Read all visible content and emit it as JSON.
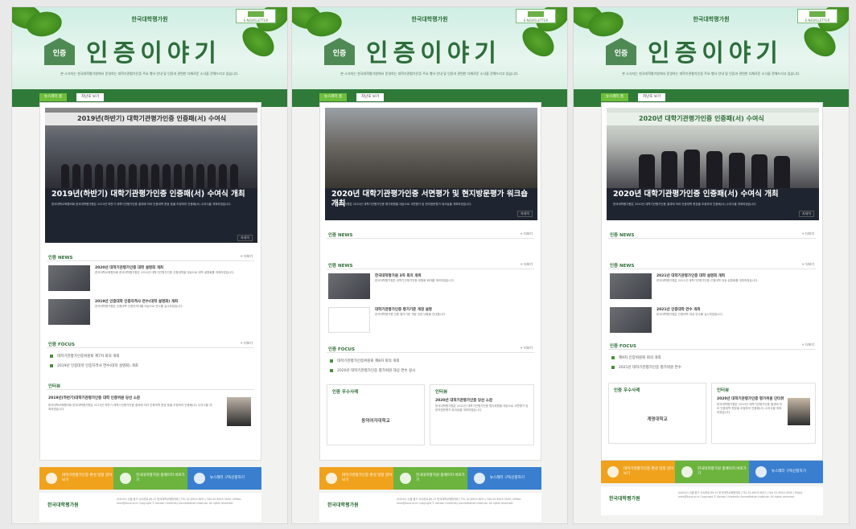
{
  "common": {
    "org_name": "한국대학평가원",
    "newsletter_label": "E-NEWSLETTER",
    "badge_label": "인증",
    "page_title": "인증이야기",
    "intro_text": "본 소식지는 한국대학평가원에서 운영하는 대학기관평가인증 주요 행사 안내 및 인증과 관련한 다채로운 소식을 전해드리고 있습니다.",
    "tab_newsletter": "뉴스레터 홈",
    "tab_archive": "지난호 보기",
    "more": "+ 더보기",
    "detail": "자세히",
    "section_news": "인증 NEWS",
    "section_focus": "인증 FOCUS",
    "section_interview": "인터뷰",
    "section_best": "인증 우수사례",
    "footer_btn1": "대학기관평가인증 편성 일정 알아보기",
    "footer_btn2": "한국대학평가원 홈페이지 바로가기",
    "footer_btn3": "뉴스레터 구독신청하기",
    "footer_logo": "한국대학평가원",
    "footer_text": "(04520) 서울 중구 서소문로 89-31 한국대학교육협의회 | TEL 02-6919-3831 | FAX 02-6919-3939 | EMAIL aims@kcue.or.kr Copyright © Korean University Accreditation Institute. All rights reserved."
  },
  "panels": [
    {
      "feature_banner": "2019년(하반기) 대학기관평가인증 인증패(서) 수여식",
      "feature_title": "2019년(하반기) 대학기관평가인증 인증패(서) 수여식 개최",
      "feature_desc": "한국대학교육협의회 한국대학평가원은 2019년 하반기 대학기관평가인증 결과에 따라 인증대학 총장 등을 초청하여 인증패(서) 수여식을 개최하였습니다.",
      "news": [
        {
          "title": "2020년 대학기관평가인증 대학 설명회 개최",
          "desc": "한국대학교육협의회 한국대학평가원은 2020년 대학기관평가인증 신청대학을 대상으로 대학 설명회를 개최하였습니다."
        },
        {
          "title": "2019년 인증대학 인증자격사 연수(대학 설명회) 개최",
          "desc": "한국대학평가원은 인증대학 인증자격사를 대상으로 연수를 실시하였습니다."
        }
      ],
      "focus": [
        "대학기관평가인증위원회 제7차 회의 개최",
        "2019년 인증대학 인증자격사 연수(대학 설명회) 개최"
      ],
      "interview_title": "2019년(하반기)대학기관평가인증 대학 인증위원 당선 소감"
    },
    {
      "feature_banner": "",
      "feature_title": "2020년 대학기관평가인증 서면평가 및 현지방문평가 워크숍 개최",
      "feature_desc": "한국대학평가원은 2020년 대학기관평가인증 평가위원을 대상으로 서면평가 및 현지방문평가 워크숍을 개최하였습니다.",
      "news": [
        {
          "title": "한국대학평가원 3차 회의 개최",
          "desc": "한국대학평가원은 대학기관평가인증 위원회 회의를 개최하였습니다."
        },
        {
          "title": "대학기관평가인증 평가기준 개정 설명",
          "desc": "한국대학평가원 인증 평가기준 개정 관련 내용을 안내합니다."
        }
      ],
      "focus": [
        "대학기관평가인증위원회 제8차 회의 개최",
        "2020년 대학기관평가인증 평가위원 대상 연수 실시"
      ],
      "best_school": "동덕여자대학교",
      "interview_title": "2020년 대학기관평가인증 당선 소감"
    },
    {
      "feature_banner": "2020년 대학기관평가인증 인증패(서) 수여식",
      "feature_title": "2020년 대학기관평가인증 인증패(서) 수여식 개최",
      "feature_desc": "한국대학평가원은 2020년 대학기관평가인증 결과에 따라 인증대학 총장을 초청하여 인증패(서) 수여식을 개최하였습니다.",
      "news": [
        {
          "title": "2021년 대학기관평가인증 대학 설명회 개최",
          "desc": "한국대학평가원은 2021년 대학기관평가인증 신청대학 대상 설명회를 개최하였습니다."
        },
        {
          "title": "2021년 인증대학 연수 개최",
          "desc": "한국대학평가원은 인증대학 대상 연수를 실시하였습니다."
        }
      ],
      "focus": [
        "제9차 인증위원회 회의 개최",
        "2021년 대학기관평가인증 평가위원 연수"
      ],
      "best_school": "계명대학교",
      "interview_title": "2020년 대학기관평가인증 평가위원 인터뷰"
    }
  ]
}
